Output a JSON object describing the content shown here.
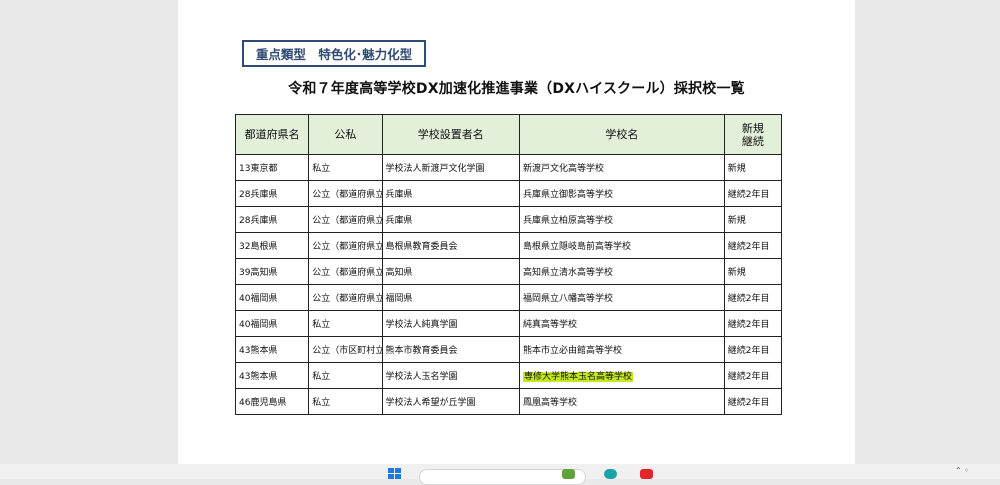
{
  "doc": {
    "tag": "重点類型　特色化･魅力化型",
    "title": "令和７年度高等学校DX加速化推進事業（DXハイスクール）採択校一覧"
  },
  "table": {
    "headers": [
      "都道府県名",
      "公私",
      "学校設置者名",
      "学校名",
      "新規\n継続"
    ],
    "rows": [
      [
        "13東京都",
        "私立",
        "学校法人新渡戸文化学園",
        "新渡戸文化高等学校",
        "新規"
      ],
      [
        "28兵庫県",
        "公立（都道府県立）",
        "兵庫県",
        "兵庫県立御影高等学校",
        "継続2年目"
      ],
      [
        "28兵庫県",
        "公立（都道府県立）",
        "兵庫県",
        "兵庫県立柏原高等学校",
        "新規"
      ],
      [
        "32島根県",
        "公立（都道府県立）",
        "島根県教育委員会",
        "島根県立隠岐島前高等学校",
        "継続2年目"
      ],
      [
        "39高知県",
        "公立（都道府県立）",
        "高知県",
        "高知県立清水高等学校",
        "新規"
      ],
      [
        "40福岡県",
        "公立（都道府県立）",
        "福岡県",
        "福岡県立八幡高等学校",
        "継続2年目"
      ],
      [
        "40福岡県",
        "私立",
        "学校法人純真学園",
        "純真高等学校",
        "継続2年目"
      ],
      [
        "43熊本県",
        "公立（市区町村立）",
        "熊本市教育委員会",
        "熊本市立必由館高等学校",
        "継続2年目"
      ],
      [
        "43熊本県",
        "私立",
        "学校法人玉名学園",
        "専修大学熊本玉名高等学校",
        "継続2年目"
      ],
      [
        "46鹿児島県",
        "私立",
        "学校法人希望が丘学園",
        "鳳凰高等学校",
        "継続2年目"
      ]
    ],
    "highlighted_row_index": 8
  },
  "colors": {
    "header_fill": "#e2efd9",
    "highlight": "#c4e820",
    "tag_border": "#2f4b73"
  }
}
